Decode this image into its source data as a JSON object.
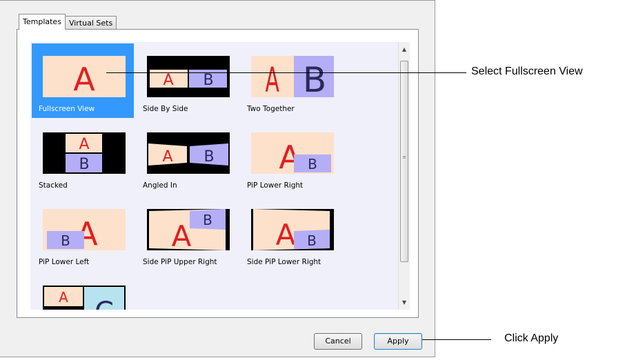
{
  "tabs": [
    {
      "label": "Templates"
    },
    {
      "label": "Virtual Sets"
    }
  ],
  "templates": [
    {
      "label": "Fullscreen View"
    },
    {
      "label": "Side By Side"
    },
    {
      "label": "Two Together"
    },
    {
      "label": "Stacked"
    },
    {
      "label": "Angled In"
    },
    {
      "label": "PiP Lower Right"
    },
    {
      "label": "PiP Lower Left"
    },
    {
      "label": "Side PiP Upper Right"
    },
    {
      "label": "Side PiP Lower Right"
    },
    {
      "label": ""
    }
  ],
  "selected_template": "Fullscreen View",
  "buttons": {
    "cancel": "Cancel",
    "apply": "Apply"
  },
  "annotations": {
    "select": "Select Fullscreen View",
    "apply": "Click Apply"
  },
  "thumb_glyphs": {
    "a": "A",
    "b": "B",
    "c": "C"
  },
  "scrollbar": {
    "up_icon": "▲",
    "down_icon": "▼",
    "grip_icon": "≡"
  },
  "colors": {
    "selection": "#3399ff",
    "frame_bg": "#fde1cb",
    "b_bg": "#b4aef7",
    "a_text": "#e02020",
    "b_text": "#2a2a5a"
  }
}
